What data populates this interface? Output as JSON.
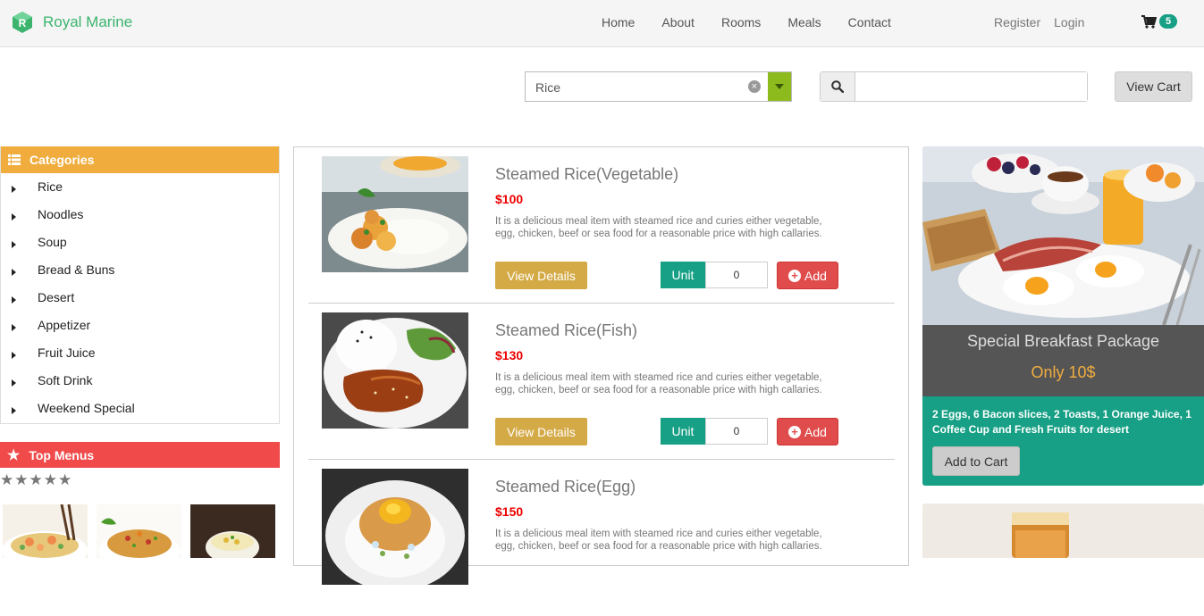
{
  "brand": {
    "name": "Royal Marine",
    "logo_letter": "R",
    "color": "#3cb46e"
  },
  "nav": {
    "links": [
      "Home",
      "About",
      "Rooms",
      "Meals",
      "Contact"
    ]
  },
  "auth": {
    "register": "Register",
    "login": "Login"
  },
  "cart": {
    "icon": "cart-icon",
    "count": "5"
  },
  "search_bar": {
    "select_value": "Rice",
    "search_value": "",
    "view_cart_label": "View Cart"
  },
  "categories": {
    "title": "Categories",
    "items": [
      "Rice",
      "Noodles",
      "Soup",
      "Bread & Buns",
      "Desert",
      "Appetizer",
      "Fruit Juice",
      "Soft Drink",
      "Weekend Special"
    ]
  },
  "top_menus": {
    "title": "Top Menus",
    "rating_stars": "★★★★★"
  },
  "products": [
    {
      "title": "Steamed Rice(Vegetable)",
      "price": "$100",
      "description": "It is a delicious meal item with steamed rice and curies either vegetable, egg, chicken, beef or sea food for a reasonable price with high callaries.",
      "details_label": "View Details",
      "unit_label": "Unit",
      "unit_value": "0",
      "add_label": "Add"
    },
    {
      "title": "Steamed Rice(Fish)",
      "price": "$130",
      "description": "It is a delicious meal item with steamed rice and curies either vegetable, egg, chicken, beef or sea food for a reasonable price with high callaries.",
      "details_label": "View Details",
      "unit_label": "Unit",
      "unit_value": "0",
      "add_label": "Add"
    },
    {
      "title": "Steamed Rice(Egg)",
      "price": "$150",
      "description": "It is a delicious meal item with steamed rice and curies either vegetable, egg, chicken, beef or sea food for a reasonable price with high callaries.",
      "details_label": "View Details",
      "unit_label": "Unit",
      "unit_value": "0",
      "add_label": "Add"
    }
  ],
  "promo": {
    "title": "Special Breakfast Package",
    "price": "Only 10$",
    "description": "2 Eggs, 6 Bacon slices, 2 Toasts, 1 Orange Juice, 1 Coffee Cup and Fresh Fruits for desert",
    "button_label": "Add to Cart"
  },
  "colors": {
    "accent_teal": "#17a085",
    "accent_orange": "#f0ad3e",
    "accent_red": "#f04a4a",
    "price_red": "#ee0000",
    "details_gold": "#d4aa47"
  }
}
